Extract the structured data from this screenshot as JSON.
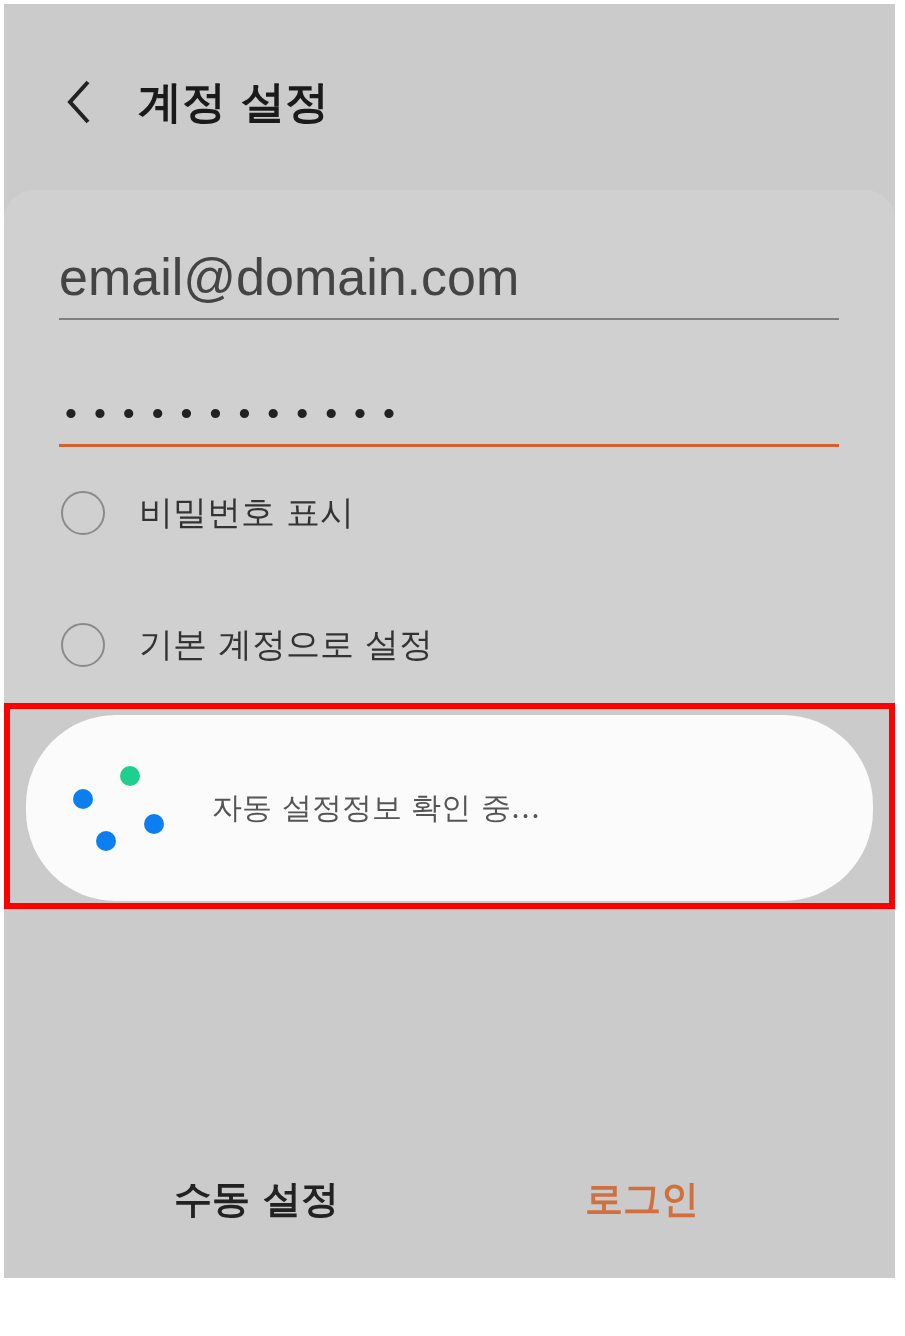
{
  "header": {
    "title": "계정 설정"
  },
  "email": {
    "value": "email@domain.com"
  },
  "password": {
    "value": "••••••••••••",
    "focused": true
  },
  "options": [
    {
      "label": "비밀번호 표시",
      "checked": false
    },
    {
      "label": "기본 계정으로 설정",
      "checked": false
    }
  ],
  "dialog": {
    "message": "자동 설정정보 확인 중…"
  },
  "buttons": [
    {
      "label": "수동 설정",
      "primary": false
    },
    {
      "label": "로그인",
      "primary": true
    }
  ]
}
